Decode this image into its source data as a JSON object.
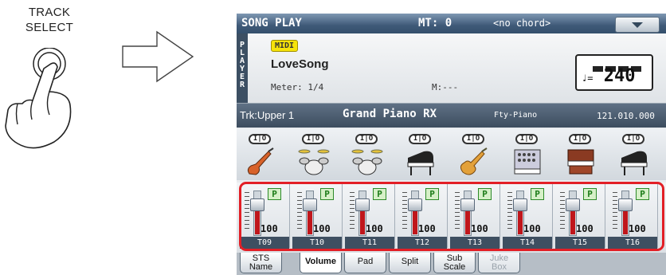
{
  "caption": {
    "line1": "TRACK",
    "line2": "SELECT"
  },
  "titlebar": {
    "title": "SONG PLAY",
    "mt": "MT: 0",
    "chord": "<no chord>",
    "menu_icon": "chevron-down-icon"
  },
  "player": {
    "side_label": [
      "P",
      "L",
      "A",
      "Y",
      "E",
      "R"
    ],
    "midi_badge": "MIDI",
    "song_name": "LoveSong",
    "meter": "Meter: 1/4",
    "measure": "M:---",
    "tempo_symbol": "♩=",
    "tempo": "240"
  },
  "track_info": {
    "part": "Trk:Upper 1",
    "sound": "Grand Piano RX",
    "category": "Fty-Piano",
    "number": "121.010.000"
  },
  "instruments": [
    {
      "io": "I|O",
      "icon": "electric-guitar-icon"
    },
    {
      "io": "I|O",
      "icon": "drum-kit-icon"
    },
    {
      "io": "I|O",
      "icon": "drum-kit-icon"
    },
    {
      "io": "I|O",
      "icon": "grand-piano-icon"
    },
    {
      "io": "I|O",
      "icon": "acoustic-guitar-icon"
    },
    {
      "io": "I|O",
      "icon": "synth-pad-icon"
    },
    {
      "io": "I|O",
      "icon": "organ-icon"
    },
    {
      "io": "I|O",
      "icon": "grand-piano-icon"
    }
  ],
  "channels": [
    {
      "label": "T09",
      "value": "100",
      "p": "P"
    },
    {
      "label": "T10",
      "value": "100",
      "p": "P"
    },
    {
      "label": "T11",
      "value": "100",
      "p": "P"
    },
    {
      "label": "T12",
      "value": "100",
      "p": "P"
    },
    {
      "label": "T13",
      "value": "100",
      "p": "P"
    },
    {
      "label": "T14",
      "value": "100",
      "p": "P"
    },
    {
      "label": "T15",
      "value": "100",
      "p": "P"
    },
    {
      "label": "T16",
      "value": "100",
      "p": "P"
    }
  ],
  "tabs": [
    {
      "l1": "STS",
      "l2": "Name"
    },
    {
      "l1": "Volume",
      "l2": ""
    },
    {
      "l1": "Pad",
      "l2": ""
    },
    {
      "l1": "Split",
      "l2": ""
    },
    {
      "l1": "Sub",
      "l2": "Scale"
    },
    {
      "l1": "Juke",
      "l2": "Box"
    }
  ],
  "colors": {
    "highlight": "#e21f26",
    "fader_fill": "#c0161b",
    "title_bg": "#3f5a78"
  }
}
